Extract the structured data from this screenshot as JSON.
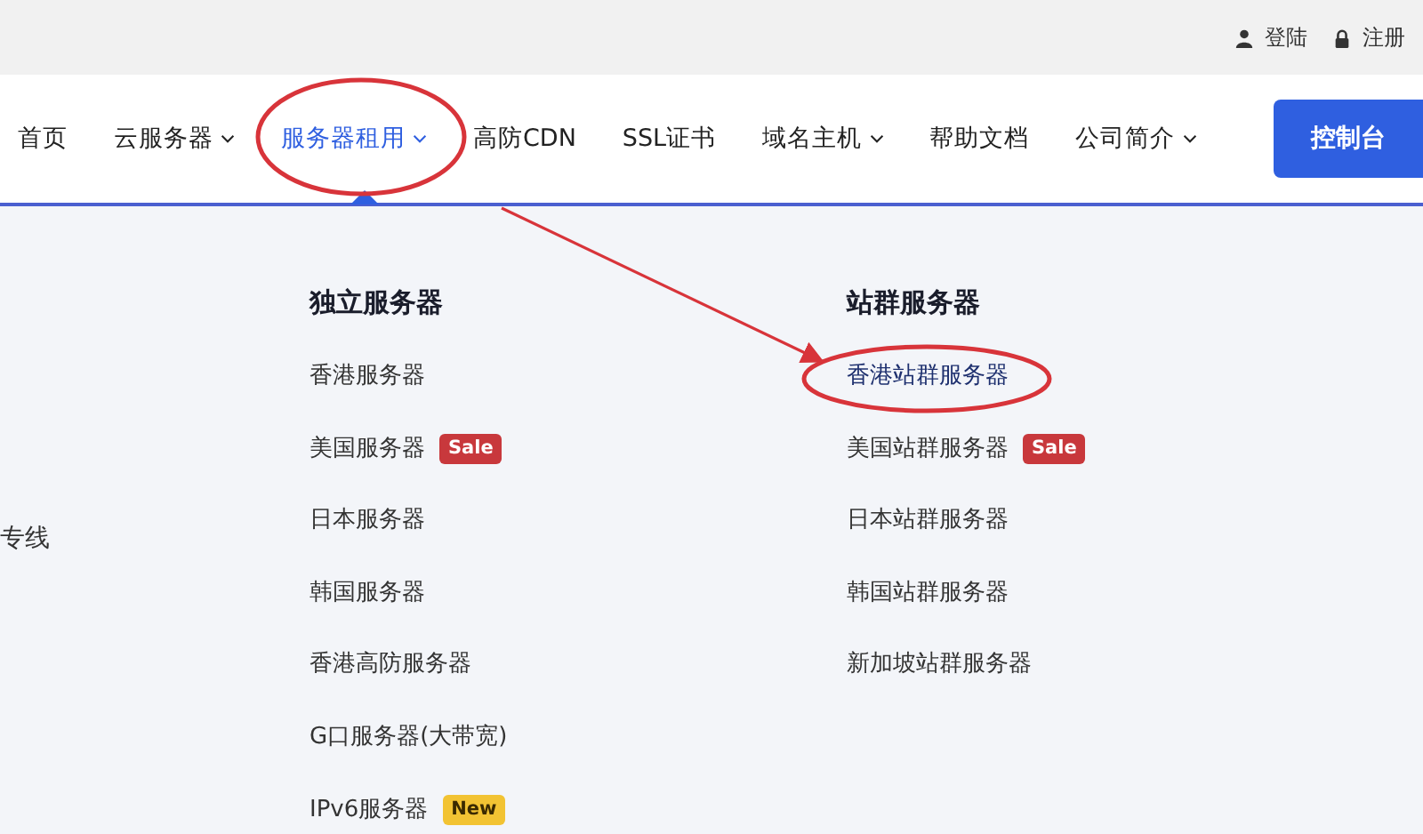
{
  "top_bar": {
    "links": [
      {
        "label": "登陆",
        "kind": "user"
      },
      {
        "label": "注册",
        "kind": "lock"
      }
    ]
  },
  "nav": {
    "items": [
      {
        "label": "首页",
        "has_menu": false,
        "selected": false
      },
      {
        "label": "云服务器",
        "has_menu": true,
        "selected": false
      },
      {
        "label": "服务器租用",
        "has_menu": true,
        "selected": true
      },
      {
        "label": "高防CDN",
        "has_menu": false,
        "selected": false
      },
      {
        "label": "SSL证书",
        "has_menu": false,
        "selected": false
      },
      {
        "label": "域名主机",
        "has_menu": true,
        "selected": false
      },
      {
        "label": "帮助文档",
        "has_menu": false,
        "selected": false
      },
      {
        "label": "公司简介",
        "has_menu": true,
        "selected": false
      }
    ],
    "button": "控制台"
  },
  "dropdown": {
    "side_text": "专线",
    "columns": [
      {
        "heading": "独立服务器",
        "items": [
          {
            "label": "香港服务器",
            "selected": false
          },
          {
            "label": "美国服务器",
            "selected": false,
            "badge": {
              "text": "Sale",
              "kind": "sale"
            }
          },
          {
            "label": "日本服务器",
            "selected": false
          },
          {
            "label": "韩国服务器",
            "selected": false
          },
          {
            "label": "香港高防服务器",
            "selected": false
          },
          {
            "label": "G口服务器(大带宽)",
            "selected": false
          },
          {
            "label": "IPv6服务器",
            "selected": false,
            "badge": {
              "text": "New",
              "kind": "new"
            }
          }
        ]
      },
      {
        "heading": "站群服务器",
        "items": [
          {
            "label": "香港站群服务器",
            "selected": true
          },
          {
            "label": "美国站群服务器",
            "selected": false,
            "badge": {
              "text": "Sale",
              "kind": "sale"
            }
          },
          {
            "label": "日本站群服务器",
            "selected": false
          },
          {
            "label": "韩国站群服务器",
            "selected": false
          },
          {
            "label": "新加坡站群服务器",
            "selected": false
          }
        ]
      }
    ]
  }
}
